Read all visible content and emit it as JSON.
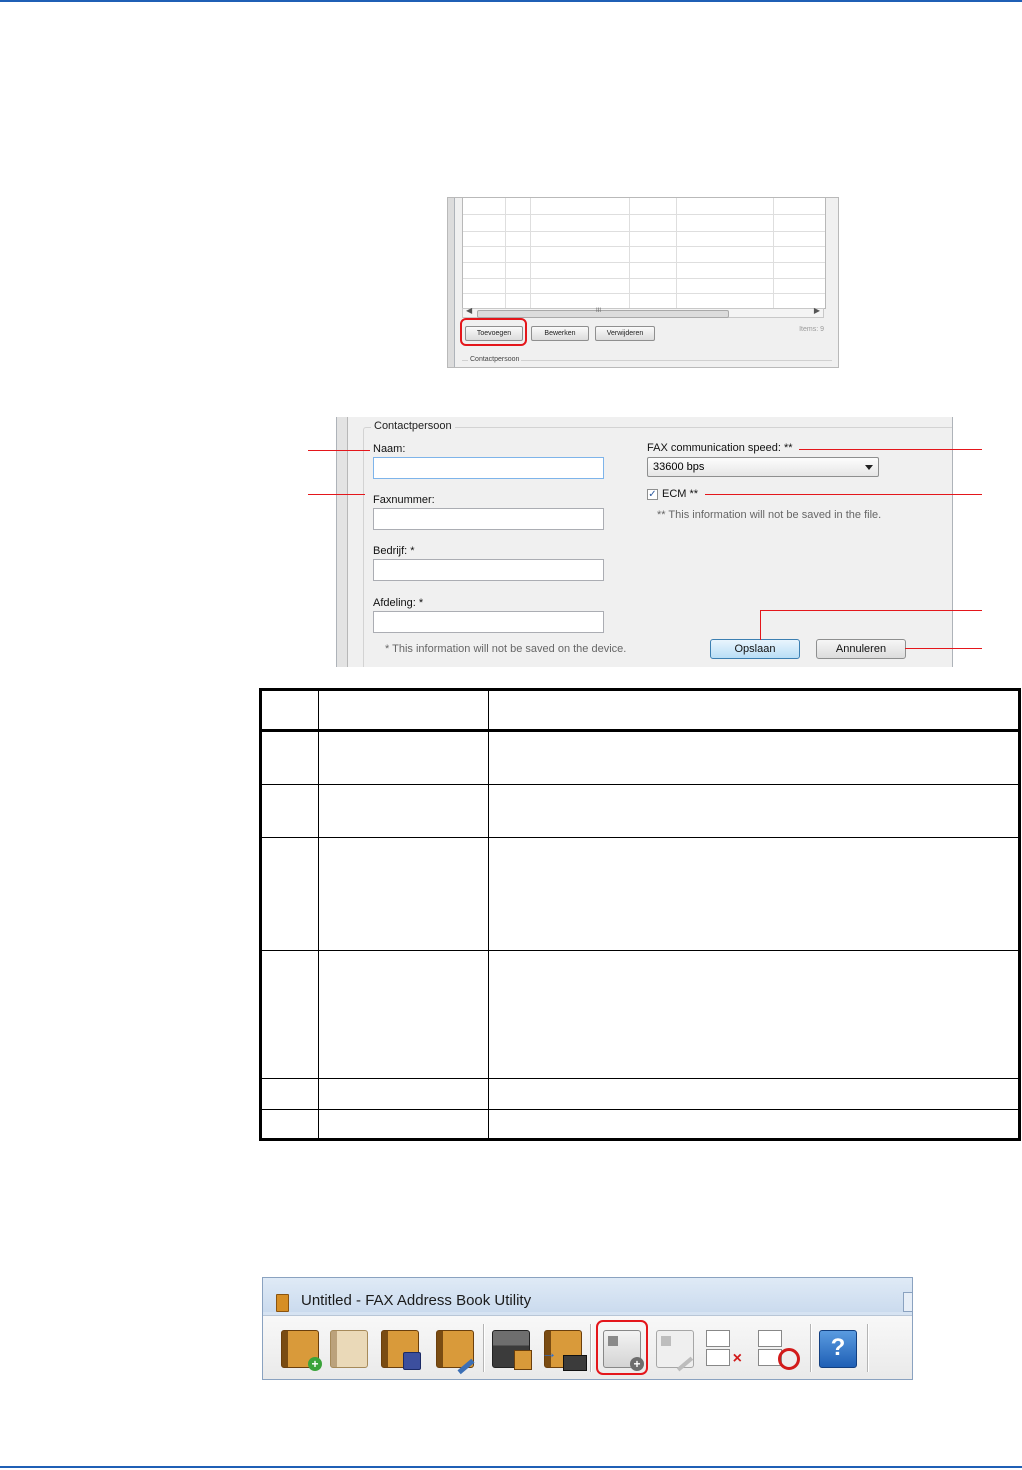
{
  "list_window": {
    "buttons": {
      "add": "Toevoegen",
      "edit": "Bewerken",
      "delete": "Verwijderen"
    },
    "items_label": "Items: 9",
    "scroll_center_mark": "III",
    "group_label": "Contactpersoon"
  },
  "contact_form": {
    "group_title": "Contactpersoon",
    "name_label": "Naam:",
    "fax_label": "Faxnummer:",
    "company_label": "Bedrijf: *",
    "department_label": "Afdeling: *",
    "device_note": "* This information will not be saved on the device.",
    "speed_label": "FAX communication speed: **",
    "speed_value": "33600 bps",
    "ecm_label": "ECM **",
    "file_note": "** This information will not be saved in the file.",
    "save_button": "Opslaan",
    "cancel_button": "Annuleren"
  },
  "toolbar_window": {
    "title": "Untitled - FAX Address Book Utility",
    "help_glyph": "?"
  },
  "colors": {
    "accent_rule": "#1f5fb5",
    "callout_red": "#e4161b"
  }
}
